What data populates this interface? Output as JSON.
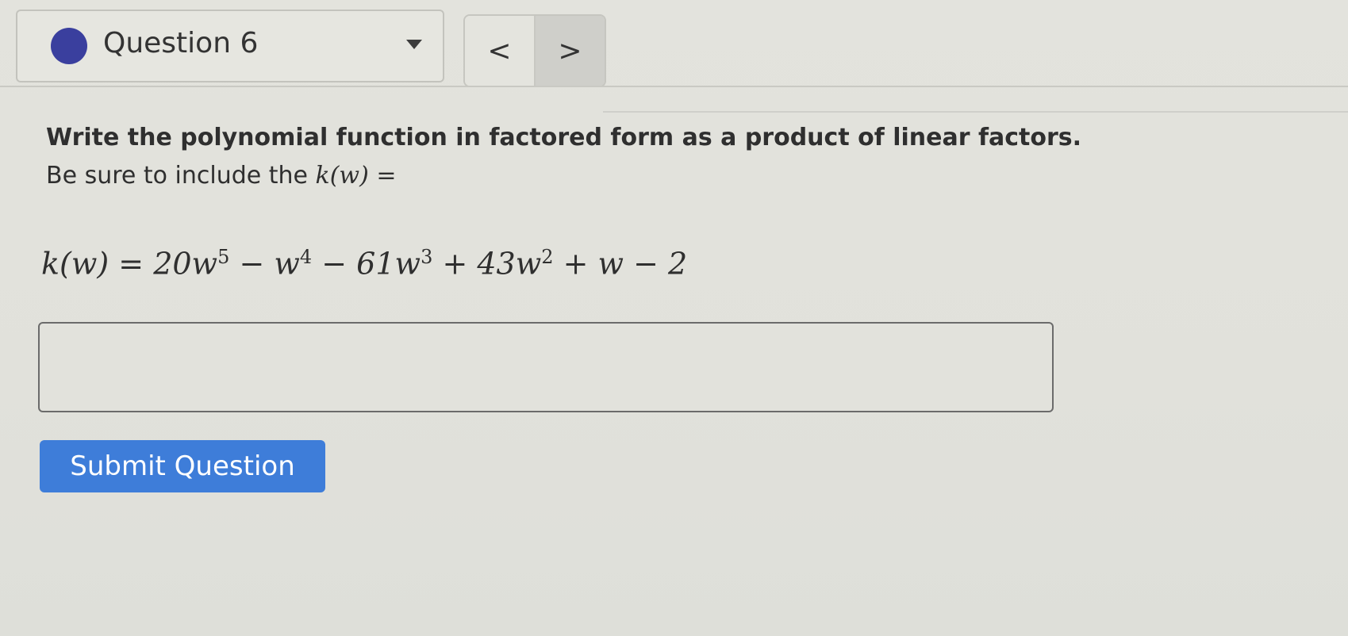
{
  "header": {
    "question_title": "Question 6",
    "prev_label": "<",
    "next_label": ">"
  },
  "prompt": {
    "line1": "Write the polynomial function in factored form as a product of linear factors.",
    "line2_text": "Be sure to include the ",
    "line2_math": "k(w) ="
  },
  "equation": {
    "lhs": "k(w) = ",
    "t1": "20w",
    "e1": "5",
    "t2": " − w",
    "e2": "4",
    "t3": " − 61w",
    "e3": "3",
    "t4": " + 43w",
    "e4": "2",
    "t5": " + w − 2"
  },
  "answer": {
    "value": "",
    "placeholder": ""
  },
  "submit_label": "Submit Question",
  "colors": {
    "status_dot": "#3a3f9e",
    "submit_bg": "#3e7dd9"
  }
}
